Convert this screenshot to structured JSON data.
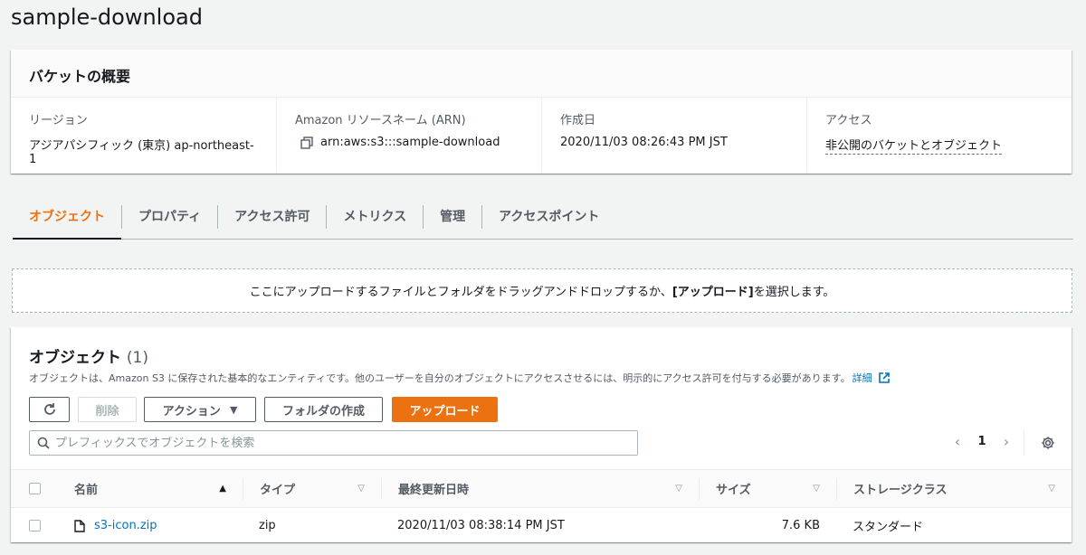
{
  "page": {
    "title": "sample-download"
  },
  "overview": {
    "header": "バケットの概要",
    "region_label": "リージョン",
    "region_value": "アジアパシフィック (東京) ap-northeast-1",
    "arn_label": "Amazon リソースネーム (ARN)",
    "arn_value": "arn:aws:s3:::sample-download",
    "created_label": "作成日",
    "created_value": "2020/11/03 08:26:43 PM JST",
    "access_label": "アクセス",
    "access_value": "非公開のバケットとオブジェクト"
  },
  "tabs": [
    {
      "label": "オブジェクト",
      "active": true
    },
    {
      "label": "プロパティ"
    },
    {
      "label": "アクセス許可"
    },
    {
      "label": "メトリクス"
    },
    {
      "label": "管理"
    },
    {
      "label": "アクセスポイント"
    }
  ],
  "dropzone": {
    "text_before": "ここにアップロードするファイルとフォルダをドラッグアンドドロップするか、",
    "text_bold": "[アップロード]",
    "text_after": " を選択します。"
  },
  "objects": {
    "title": "オブジェクト",
    "count": "(1)",
    "description": "オブジェクトは、Amazon S3 に保存された基本的なエンティティです。他のユーザーを自分のオブジェクトにアクセスさせるには、明示的にアクセス許可を付与する必要があります。",
    "details_link": "詳細",
    "buttons": {
      "delete": "削除",
      "actions": "アクション",
      "create_folder": "フォルダの作成",
      "upload": "アップロード"
    },
    "search_placeholder": "プレフィックスでオブジェクトを検索",
    "pagination": {
      "current_page": "1"
    },
    "columns": [
      "名前",
      "タイプ",
      "最終更新日時",
      "サイズ",
      "ストレージクラス"
    ],
    "rows": [
      {
        "name": "s3-icon.zip",
        "type": "zip",
        "modified": "2020/11/03 08:38:14 PM JST",
        "size": "7.6 KB",
        "storage_class": "スタンダード"
      }
    ]
  },
  "colors": {
    "accent": "#ec7211",
    "link": "#0073bb"
  }
}
